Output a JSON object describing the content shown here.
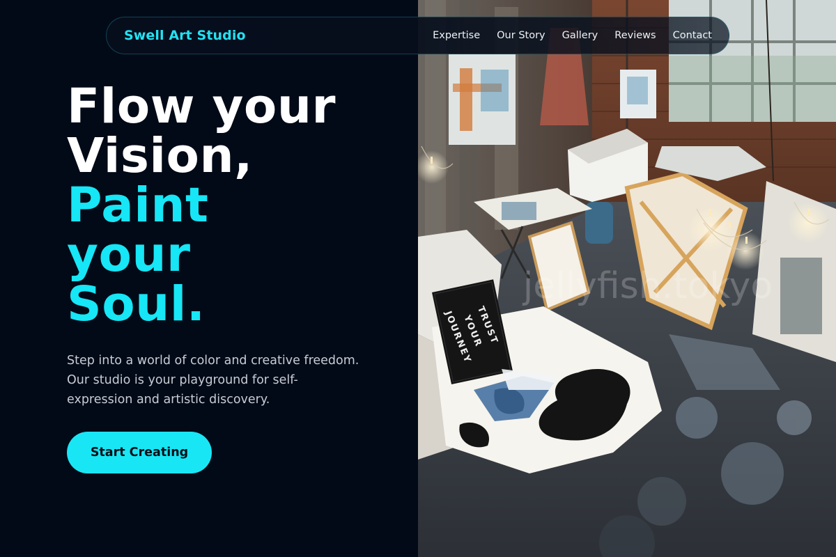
{
  "nav": {
    "brand": "Swell Art Studio",
    "links": [
      "Expertise",
      "Our Story",
      "Gallery",
      "Reviews",
      "Contact"
    ]
  },
  "hero": {
    "headline": {
      "line1": "Flow your",
      "line2": "Vision,",
      "line3": "Paint",
      "line4": "your",
      "line5": "Soul."
    },
    "description": "Step into a world of color and creative freedom. Our studio is your playground for self-expression and artistic discovery.",
    "cta_label": "Start Creating"
  },
  "image": {
    "sign_text": [
      "TRUST",
      "YOUR",
      "JOURNEY"
    ],
    "watermark": "jellyfish.tokyo"
  },
  "colors": {
    "background": "#030a17",
    "accent": "#19e6f5",
    "heading": "#ffffff",
    "body_text": "#c7cdd6"
  }
}
